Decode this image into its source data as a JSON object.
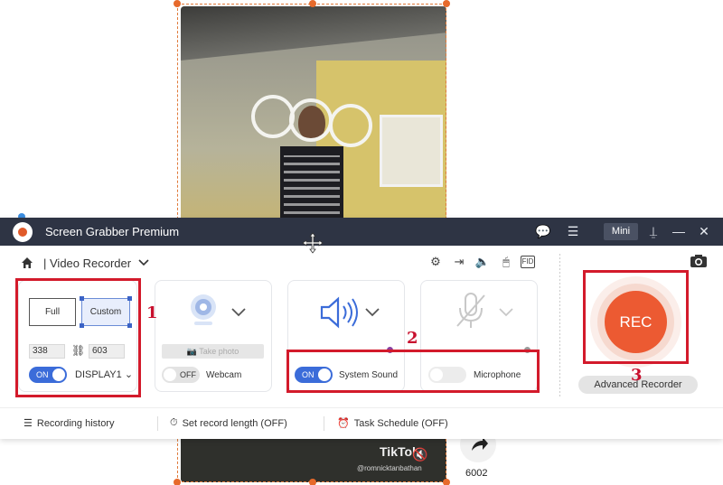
{
  "window": {
    "title": "Screen Grabber Premium",
    "mini_label": "Mini"
  },
  "toolbar": {
    "mode_label": "| Video Recorder"
  },
  "area": {
    "full_label": "Full",
    "custom_label": "Custom",
    "width_value": "338",
    "height_value": "603",
    "toggle_label": "ON",
    "display_label": "DISPLAY1"
  },
  "webcam": {
    "take_photo_label": "Take photo",
    "toggle_label": "OFF",
    "label": "Webcam"
  },
  "system_sound": {
    "toggle_label": "ON",
    "label": "System Sound"
  },
  "microphone": {
    "label": "Microphone"
  },
  "rec": {
    "label": "REC",
    "advanced_label": "Advanced Recorder"
  },
  "bottom": {
    "history_label": "Recording history",
    "length_label": "Set record length (OFF)",
    "schedule_label": "Task Schedule (OFF)"
  },
  "annotations": {
    "one": "1",
    "two": "2",
    "three": "3"
  },
  "video_overlay": {
    "brand": "TikTok",
    "username": "@romnicktanbathan",
    "share_count": "6002"
  },
  "colors": {
    "titlebar": "#2e3444",
    "accent_blue": "#3b6cd9",
    "rec_orange": "#ec5a32",
    "annotation_red": "#d31a2b"
  },
  "icons": {
    "home": "home-icon",
    "settings": "gear-icon",
    "export": "export-icon",
    "speaker": "speaker-icon",
    "mouse": "mouse-icon",
    "fid": "fid-icon",
    "camera": "camera-icon",
    "webcam": "webcam-icon",
    "mic": "microphone-muted-icon"
  }
}
